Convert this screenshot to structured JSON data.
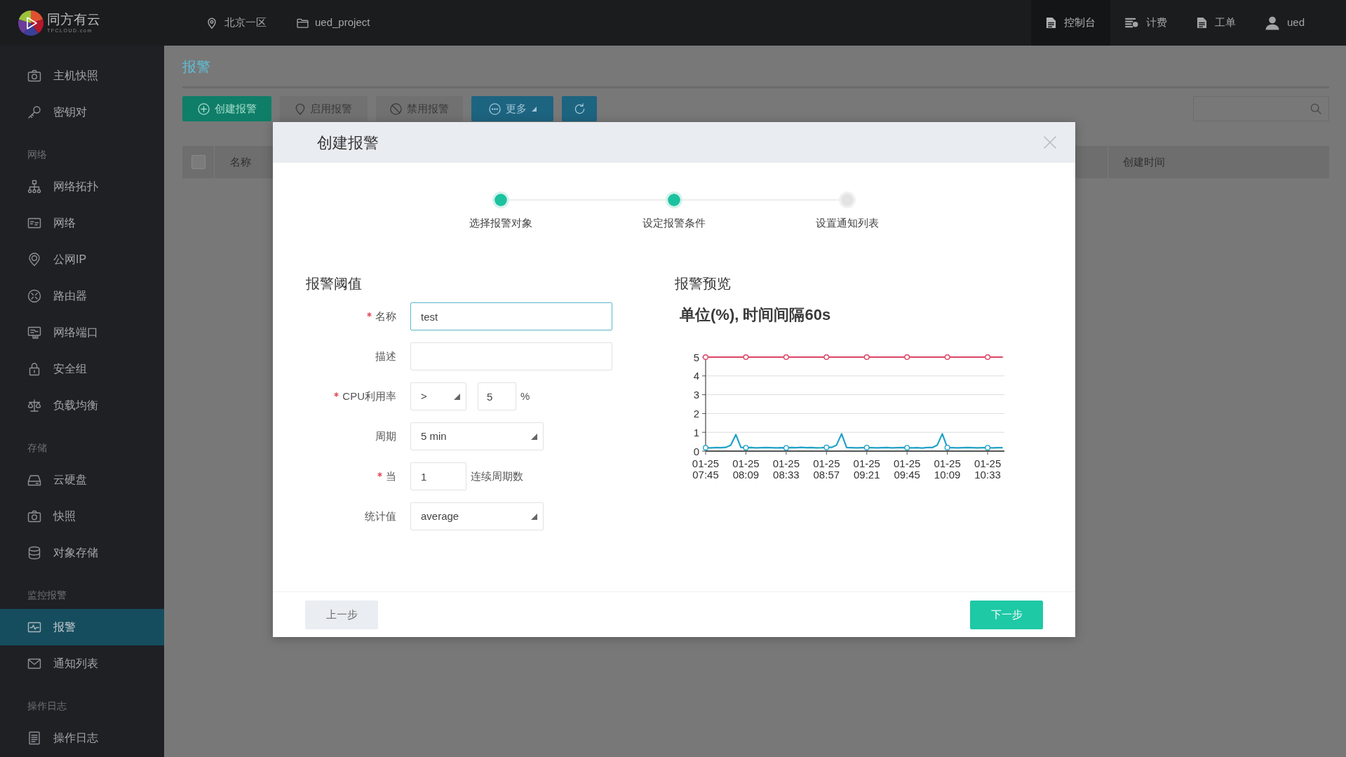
{
  "top_bar": {
    "brand": {
      "name": "同方有云",
      "tagline": "TFCLOUD.com"
    },
    "region": "北京一区",
    "project": "ued_project",
    "nav": [
      {
        "label": "控制台",
        "selected": true
      },
      {
        "label": "计费",
        "selected": false
      },
      {
        "label": "工单",
        "selected": false
      },
      {
        "label": "ued",
        "selected": false
      }
    ]
  },
  "sidebar": {
    "groups": [
      {
        "items": [
          {
            "label": "主机快照",
            "selected": false
          },
          {
            "label": "密钥对",
            "selected": false
          }
        ]
      },
      {
        "heading": "网络",
        "items": [
          {
            "label": "网络拓扑",
            "selected": false
          },
          {
            "label": "网络",
            "selected": false
          },
          {
            "label": "公网IP",
            "selected": false
          },
          {
            "label": "路由器",
            "selected": false
          },
          {
            "label": "网络端口",
            "selected": false
          },
          {
            "label": "安全组",
            "selected": false
          },
          {
            "label": "负载均衡",
            "selected": false
          }
        ]
      },
      {
        "heading": "存储",
        "items": [
          {
            "label": "云硬盘",
            "selected": false
          },
          {
            "label": "快照",
            "selected": false
          },
          {
            "label": "对象存储",
            "selected": false
          }
        ]
      },
      {
        "heading": "监控报警",
        "items": [
          {
            "label": "报警",
            "selected": true
          },
          {
            "label": "通知列表",
            "selected": false
          }
        ]
      },
      {
        "heading": "操作日志",
        "items": [
          {
            "label": "操作日志",
            "selected": false
          }
        ]
      }
    ]
  },
  "page": {
    "title": "报警",
    "toolbar": [
      {
        "kind": "create",
        "label": "创建报警",
        "disabled": false
      },
      {
        "kind": "enable",
        "label": "启用报警",
        "disabled": true
      },
      {
        "kind": "disable",
        "label": "禁用报警",
        "disabled": true
      },
      {
        "kind": "more",
        "label": "更多",
        "disabled": false
      },
      {
        "kind": "refresh",
        "disabled": false
      }
    ],
    "table": {
      "select_all": {
        "checked": false
      },
      "columns": [
        "名称",
        "创建时间"
      ]
    }
  },
  "modal": {
    "title": "创建报警",
    "steps": [
      {
        "label": "选择报警对象",
        "done": true
      },
      {
        "label": "设定报警条件",
        "done": true
      },
      {
        "label": "设置通知列表",
        "done": false
      }
    ],
    "threshold": {
      "heading": "报警阈值",
      "fields": [
        {
          "kind": "text",
          "label": "名称",
          "required": true,
          "value": "test",
          "focused": true
        },
        {
          "kind": "text",
          "label": "描述",
          "required": false,
          "focused": false
        },
        {
          "kind": "threshold",
          "label": "CPU利用率",
          "required": true,
          "operator": ">",
          "value": "5",
          "unit": "%",
          "focused": false
        },
        {
          "kind": "select",
          "label": "周期",
          "required": false,
          "value": "5 min",
          "focused": false
        },
        {
          "kind": "count",
          "label": "当",
          "required": true,
          "value": "1",
          "suffix": "连续周期数",
          "focused": false
        },
        {
          "kind": "select",
          "label": "统计值",
          "required": false,
          "value": "average",
          "focused": false
        }
      ]
    },
    "preview": {
      "heading": "报警预览",
      "chart_data": {
        "type": "line",
        "title": "单位(%), 时间间隔60s",
        "categories": [
          "01-25 07:45",
          null,
          null,
          null,
          null,
          null,
          null,
          null,
          "01-25 08:09",
          null,
          null,
          null,
          null,
          null,
          null,
          null,
          "01-25 08:33",
          null,
          null,
          null,
          null,
          null,
          null,
          null,
          "01-25 08:57",
          null,
          null,
          null,
          null,
          null,
          null,
          null,
          "01-25 09:21",
          null,
          null,
          null,
          null,
          null,
          null,
          null,
          "01-25 09:45",
          null,
          null,
          null,
          null,
          null,
          null,
          null,
          "01-25 10:09",
          null,
          null,
          null,
          null,
          null,
          null,
          null,
          "01-25 10:33",
          null,
          null,
          null
        ],
        "series": [
          {
            "color": "#dd4466",
            "values": [
              5,
              5,
              5,
              5,
              5,
              5,
              5,
              5,
              5,
              5,
              5,
              5,
              5,
              5,
              5,
              5,
              5,
              5,
              5,
              5,
              5,
              5,
              5,
              5,
              5,
              5,
              5,
              5,
              5,
              5,
              5,
              5,
              5,
              5,
              5,
              5,
              5,
              5,
              5,
              5,
              5,
              5,
              5,
              5,
              5,
              5,
              5,
              5,
              5,
              5,
              5,
              5,
              5,
              5,
              5,
              5,
              5,
              5,
              5,
              5
            ]
          },
          {
            "color": "#22a2c8",
            "values": [
              0.18,
              0.17,
              0.19,
              0.18,
              0.2,
              0.32,
              0.88,
              0.2,
              0.18,
              0.19,
              0.17,
              0.18,
              0.19,
              0.18,
              0.17,
              0.18,
              0.17,
              0.19,
              0.18,
              0.2,
              0.18,
              0.19,
              0.17,
              0.18,
              0.2,
              0.2,
              0.32,
              0.92,
              0.19,
              0.18,
              0.17,
              0.18,
              0.19,
              0.18,
              0.17,
              0.18,
              0.19,
              0.17,
              0.18,
              0.19,
              0.18,
              0.17,
              0.18,
              0.16,
              0.19,
              0.19,
              0.32,
              0.92,
              0.19,
              0.18,
              0.17,
              0.18,
              0.19,
              0.18,
              0.17,
              0.18,
              0.18,
              0.17,
              0.18,
              0.18
            ]
          }
        ],
        "ylim": [
          0,
          5
        ],
        "yticks": [
          0,
          1,
          2,
          3,
          4,
          5
        ],
        "grid": true
      }
    },
    "buttons": [
      {
        "kind": "secondary",
        "label": "上一步"
      },
      {
        "kind": "primary",
        "label": "下一步"
      }
    ]
  }
}
